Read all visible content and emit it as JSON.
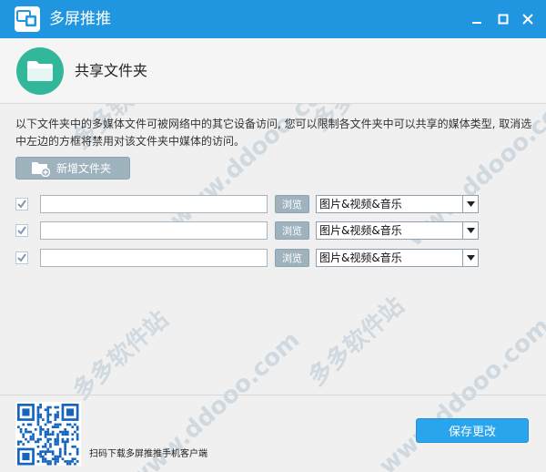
{
  "window": {
    "title": "多屏推推",
    "controls": {
      "minimize_icon": "minimize-icon",
      "maximize_icon": "maximize-icon",
      "close_icon": "close-icon"
    }
  },
  "header": {
    "icon": "folder-icon",
    "title": "共享文件夹"
  },
  "description": "以下文件夹中的多媒体文件可被网络中的其它设备访问, 您可以限制各文件夹中可以共享的媒体类型, 取消选中左边的方框将禁用对该文件夹中媒体的访问。",
  "add_button": {
    "label": "新增文件夹",
    "icon": "add-folder-icon"
  },
  "folders": [
    {
      "checked": true,
      "path": "",
      "browse_label": "浏览",
      "media_type": "图片&视频&音乐"
    },
    {
      "checked": true,
      "path": "",
      "browse_label": "浏览",
      "media_type": "图片&视频&音乐"
    },
    {
      "checked": true,
      "path": "",
      "browse_label": "浏览",
      "media_type": "图片&视频&音乐"
    }
  ],
  "footer": {
    "qr_caption": "扫码下载多屏推推手机客户端",
    "save_label": "保存更改"
  },
  "watermark": {
    "text_cn": "多多软件站",
    "text_en": "www.ddooo.com"
  },
  "colors": {
    "titlebar": "#2196e0",
    "accent": "#2aa4ec",
    "folder_icon_bg": "#33b79a",
    "secondary_button": "#9fb3bf"
  }
}
